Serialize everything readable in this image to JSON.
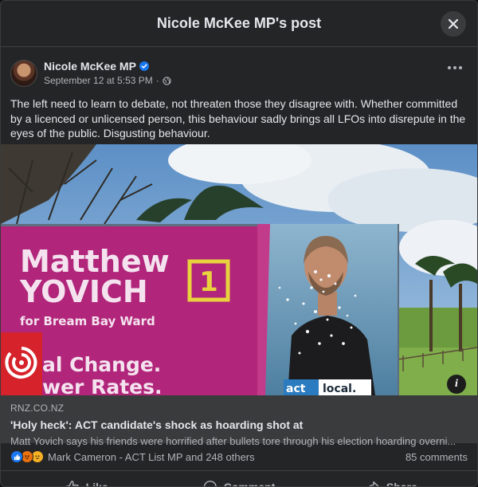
{
  "modal": {
    "title": "Nicole McKee MP's post"
  },
  "post": {
    "author": "Nicole McKee MP",
    "timestamp": "September 12 at 5:53 PM",
    "separator": "·",
    "audience_icon": "globe-icon",
    "text": "The left need to learn to debate, not threaten those they disagree with. Whether committed by a licenced or unlicensed person, this behaviour sadly brings all LFOs into disrepute in the eyes of the public. Disgusting behaviour."
  },
  "billboard": {
    "first_name": "Matthew",
    "last_name": "YOVICH",
    "ward": "for Bream Bay Ward",
    "number": "1",
    "slogan1": "al Change.",
    "slogan2": "wer Rates.",
    "brand": "act",
    "brand2": "local."
  },
  "link": {
    "domain": "RNZ.CO.NZ",
    "title": "'Holy heck': ACT candidate's shock as hoarding shot at",
    "description": "Matt Yovich says his friends were horrified after bullets tore through his election hoarding overni..."
  },
  "reactions": {
    "icons": [
      "like-reaction-icon",
      "angry-reaction-icon",
      "sad-reaction-icon"
    ],
    "summary": "Mark Cameron - ACT List MP and 248 others",
    "comments": "85 comments"
  },
  "actions": {
    "like": "Like",
    "comment": "Comment",
    "share": "Share"
  },
  "colors": {
    "accent": "#1877f2",
    "surface": "#242526",
    "link_surface": "#3a3b3c",
    "billboard_pink": "#b1257a"
  }
}
